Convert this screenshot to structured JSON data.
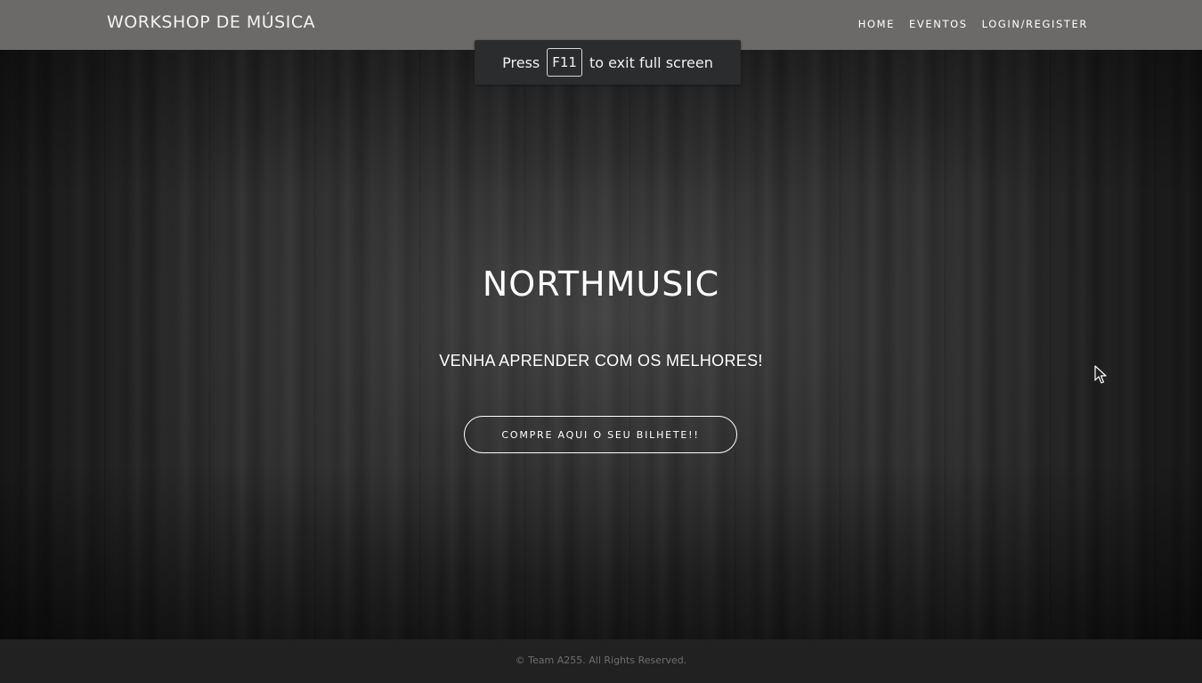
{
  "navbar": {
    "brand": "WORKSHOP DE MÚSICA",
    "links": [
      "HOME",
      "EVENTOS",
      "LOGIN/REGISTER"
    ]
  },
  "fullscreen_notice": {
    "before": "Press",
    "key": "F11",
    "after": "to exit full screen"
  },
  "hero": {
    "title": "NORTHMUSIC",
    "subtitle": "VENHA APRENDER COM OS MELHORES!",
    "cta_label": "COMPRE AQUI O SEU BILHETE!!"
  },
  "footer": {
    "text": "© Team A255. All Rights Reserved."
  },
  "colors": {
    "navbar_bg": "#6b6a68",
    "hero_bg": "#2a2a2a",
    "footer_bg": "#212121",
    "text": "#ffffff"
  }
}
